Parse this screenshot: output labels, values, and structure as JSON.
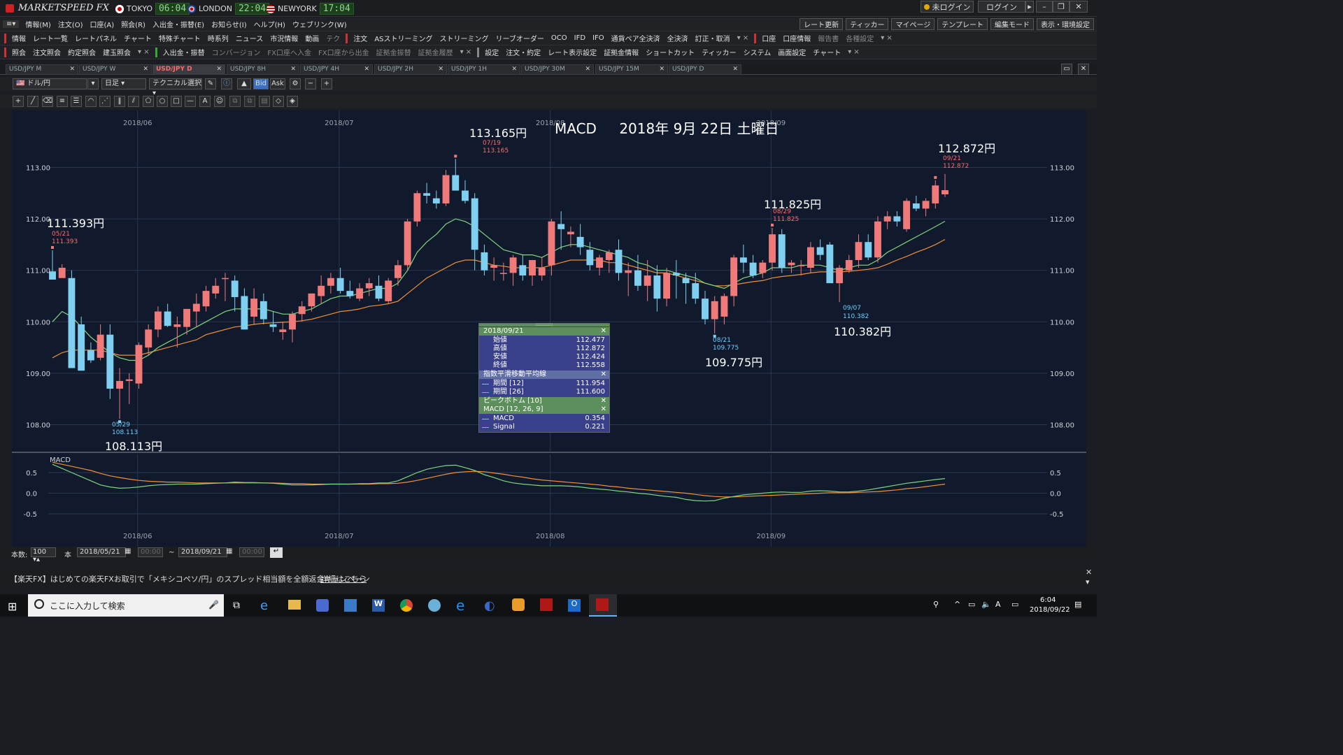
{
  "app": {
    "title": "MARKETSPEED FX"
  },
  "clocks": [
    {
      "city": "TOKYO",
      "time": "06:04"
    },
    {
      "city": "LONDON",
      "time": "22:04"
    },
    {
      "city": "NEWYORK",
      "time": "17:04"
    }
  ],
  "topright": {
    "status": "未ログイン",
    "login": "ログイン"
  },
  "menu": [
    "情報(M)",
    "注文(O)",
    "口座(A)",
    "照会(R)",
    "入出金・振替(E)",
    "お知らせ(I)",
    "ヘルプ(H)",
    "ウェブリンク(W)"
  ],
  "toolbar1_left": [
    "情報",
    "レート一覧",
    "レートパネル",
    "チャート",
    "特殊チャート",
    "時系列",
    "ニュース",
    "市況情報",
    "動画",
    "テク"
  ],
  "toolbar1_mid": [
    "注文",
    "ASストリーミング",
    "ストリーミング",
    "リーブオーダー",
    "OCO",
    "IFD",
    "IFO",
    "通貨ペア全決済",
    "全決済",
    "訂正・取消"
  ],
  "toolbar1_right": [
    "口座",
    "口座情報",
    "報告書",
    "各種設定"
  ],
  "toolbar1_far": [
    "レート更新",
    "ティッカー",
    "マイページ",
    "テンプレート",
    "編集モード",
    "表示・環境設定"
  ],
  "toolbar2_left": [
    "照会",
    "注文照会",
    "約定照会",
    "建玉照会"
  ],
  "toolbar2_mid": [
    "入出金・振替",
    "コンバージョン",
    "FX口座へ入金",
    "FX口座から出金",
    "証拠金振替",
    "証拠金履歴"
  ],
  "toolbar2_right": [
    "設定",
    "注文・約定",
    "レート表示設定",
    "証拠金情報",
    "ショートカット",
    "ティッカー",
    "システム",
    "画面設定",
    "チャート"
  ],
  "tabs": [
    "USD/JPY M",
    "USD/JPY W",
    "USD/JPY D",
    "USD/JPY 8H",
    "USD/JPY 4H",
    "USD/JPY 2H",
    "USD/JPY 1H",
    "USD/JPY 30M",
    "USD/JPY 15M",
    "USD/JPY D"
  ],
  "active_tab": 2,
  "chart_toolbar": {
    "pair": "ドル/円",
    "timeframe": "日足",
    "technical": "テクニカル選択",
    "bid": "Bid",
    "ask": "Ask"
  },
  "chart_header": {
    "indicator": "MACD",
    "date": "2018年 9月 22日 土曜日"
  },
  "annotations": {
    "a1_big": "111.393円",
    "a1_date": "05/21",
    "a1_val": "111.393",
    "a2_big": "108.113円",
    "a2_date": "05/29",
    "a2_val": "108.113",
    "a3_big": "113.165円",
    "a3_date": "07/19",
    "a3_val": "113.165",
    "a4_big": "109.775円",
    "a4_date": "08/21",
    "a4_val": "109.775",
    "a5_big": "111.825円",
    "a5_date": "08/29",
    "a5_val": "111.825",
    "a6_big": "110.382円",
    "a6_date": "09/07",
    "a6_val": "110.382",
    "a7_big": "112.872円",
    "a7_date": "09/21",
    "a7_val": "112.872"
  },
  "infobox": {
    "date": "2018/09/21",
    "ohlc": [
      {
        "label": "始値",
        "value": "112.477"
      },
      {
        "label": "高値",
        "value": "112.872"
      },
      {
        "label": "安値",
        "value": "112.424"
      },
      {
        "label": "終値",
        "value": "112.558"
      }
    ],
    "ema_title": "指数平滑移動平均線",
    "ema": [
      {
        "label": "期間 [12]",
        "value": "111.954"
      },
      {
        "label": "期間 [26]",
        "value": "111.600"
      }
    ],
    "peak_title": "ピークボトム [10]",
    "macd_title": "MACD [12, 26, 9]",
    "macd": [
      {
        "label": "MACD",
        "value": "0.354"
      },
      {
        "label": "Signal",
        "value": "0.221"
      }
    ]
  },
  "bottombar": {
    "count_label": "本数:",
    "count": "100",
    "unit": "本",
    "from": "2018/05/21",
    "time_from": "00:00",
    "tilde": "~",
    "to": "2018/09/21",
    "time_to": "00:00"
  },
  "news": {
    "text": "【楽天FX】はじめての楽天FXお取引で「メキシコペソ/円」のスプレッド相当額を全額返金キャンペーン",
    "link": "詳細はこちら"
  },
  "taskbar": {
    "search_placeholder": "ここに入力して検索",
    "time": "6:04",
    "date": "2018/09/22",
    "ime": "A"
  },
  "chart_data": {
    "type": "candlestick",
    "price_axis": {
      "ylim": [
        107.5,
        113.5
      ],
      "ticks": [
        108.0,
        109.0,
        110.0,
        111.0,
        112.0,
        113.0
      ],
      "tick_labels": [
        "108.00",
        "109.00",
        "110.00",
        "111.00",
        "112.00",
        "113.00"
      ]
    },
    "macd_axis": {
      "ylim": [
        -0.75,
        0.75
      ],
      "ticks": [
        0.5,
        0.0,
        -0.5
      ],
      "tick_labels": [
        "0.5",
        "0.0",
        "-0.5"
      ]
    },
    "month_labels": [
      {
        "label": "2018/06",
        "index": 8
      },
      {
        "label": "2018/07",
        "index": 29
      },
      {
        "label": "2018/08",
        "index": 51
      },
      {
        "label": "2018/09",
        "index": 74
      }
    ],
    "macd_label": "MACD",
    "candles": [
      [
        110.98,
        111.39,
        110.82,
        110.82
      ],
      [
        110.85,
        111.12,
        110.95,
        111.05
      ],
      [
        110.85,
        111.0,
        109.1,
        109.1
      ],
      [
        109.95,
        110.1,
        109.05,
        109.05
      ],
      [
        109.45,
        109.6,
        109.2,
        109.25
      ],
      [
        109.3,
        109.95,
        109.25,
        109.75
      ],
      [
        109.75,
        109.95,
        108.5,
        108.7
      ],
      [
        108.7,
        109.1,
        108.113,
        108.85
      ],
      [
        108.85,
        109.0,
        108.4,
        108.88
      ],
      [
        108.8,
        109.6,
        108.7,
        109.55
      ],
      [
        109.5,
        109.95,
        109.35,
        109.85
      ],
      [
        109.85,
        110.3,
        109.7,
        110.2
      ],
      [
        110.2,
        110.35,
        109.9,
        109.92
      ],
      [
        109.9,
        110.1,
        109.5,
        109.95
      ],
      [
        109.9,
        110.25,
        109.75,
        110.25
      ],
      [
        110.2,
        110.55,
        109.9,
        110.35
      ],
      [
        110.3,
        110.7,
        110.2,
        110.6
      ],
      [
        110.55,
        110.85,
        110.45,
        110.7
      ],
      [
        110.85,
        110.95,
        110.4,
        110.85
      ],
      [
        110.8,
        110.9,
        110.2,
        110.48
      ],
      [
        110.5,
        110.65,
        109.85,
        109.85
      ],
      [
        110.1,
        110.65,
        109.95,
        110.45
      ],
      [
        110.4,
        110.55,
        109.95,
        110.05
      ],
      [
        109.95,
        110.2,
        109.8,
        109.9
      ],
      [
        109.8,
        110.0,
        109.65,
        109.85
      ],
      [
        109.85,
        110.2,
        109.6,
        110.15
      ],
      [
        110.15,
        110.4,
        110.0,
        110.3
      ],
      [
        110.3,
        110.55,
        110.2,
        110.55
      ],
      [
        110.5,
        110.9,
        110.35,
        110.7
      ],
      [
        110.7,
        110.95,
        110.55,
        110.85
      ],
      [
        110.85,
        111.05,
        110.55,
        110.6
      ],
      [
        110.6,
        110.8,
        110.45,
        110.5
      ],
      [
        110.45,
        110.75,
        110.4,
        110.65
      ],
      [
        110.65,
        110.85,
        110.5,
        110.75
      ],
      [
        110.7,
        110.9,
        110.4,
        110.45
      ],
      [
        110.4,
        110.85,
        110.35,
        110.8
      ],
      [
        110.85,
        111.2,
        110.7,
        111.1
      ],
      [
        111.1,
        112.0,
        111.0,
        111.95
      ],
      [
        111.95,
        112.55,
        111.85,
        112.5
      ],
      [
        112.5,
        112.7,
        112.3,
        112.45
      ],
      [
        112.4,
        112.55,
        112.2,
        112.3
      ],
      [
        112.3,
        112.95,
        112.25,
        112.85
      ],
      [
        112.85,
        113.165,
        112.6,
        112.55
      ],
      [
        112.55,
        112.75,
        112.3,
        112.35
      ],
      [
        112.4,
        112.5,
        111.0,
        111.4
      ],
      [
        111.35,
        111.5,
        110.9,
        111.0
      ],
      [
        111.05,
        111.25,
        110.8,
        111.1
      ],
      [
        110.95,
        111.15,
        110.8,
        110.95
      ],
      [
        110.95,
        111.3,
        110.7,
        111.25
      ],
      [
        111.1,
        111.3,
        110.8,
        110.9
      ],
      [
        110.9,
        111.2,
        110.7,
        111.2
      ],
      [
        110.9,
        111.25,
        110.8,
        111.05
      ],
      [
        111.1,
        112.0,
        110.9,
        111.95
      ],
      [
        111.9,
        112.15,
        111.4,
        111.8
      ],
      [
        111.7,
        111.85,
        111.45,
        111.75
      ],
      [
        111.65,
        111.9,
        111.3,
        111.45
      ],
      [
        111.4,
        111.55,
        111.0,
        111.1
      ],
      [
        111.05,
        111.3,
        110.9,
        111.25
      ],
      [
        111.2,
        111.4,
        110.95,
        111.35
      ],
      [
        111.4,
        111.6,
        110.8,
        110.95
      ],
      [
        110.95,
        111.15,
        110.5,
        111.0
      ],
      [
        111.0,
        111.3,
        110.6,
        110.7
      ],
      [
        110.7,
        111.2,
        110.4,
        110.9
      ],
      [
        110.9,
        111.1,
        110.2,
        110.45
      ],
      [
        110.45,
        111.05,
        110.3,
        110.95
      ],
      [
        110.95,
        111.2,
        110.45,
        110.9
      ],
      [
        110.85,
        110.95,
        110.35,
        110.75
      ],
      [
        110.75,
        110.95,
        110.35,
        110.45
      ],
      [
        110.45,
        110.6,
        109.95,
        110.05
      ],
      [
        110.05,
        110.5,
        109.775,
        110.4
      ],
      [
        110.1,
        110.55,
        109.95,
        110.5
      ],
      [
        110.5,
        111.3,
        110.3,
        111.25
      ],
      [
        111.25,
        111.5,
        110.95,
        111.15
      ],
      [
        111.15,
        111.3,
        110.85,
        110.9
      ],
      [
        110.95,
        111.2,
        110.85,
        111.15
      ],
      [
        111.15,
        111.825,
        111.0,
        111.7
      ],
      [
        111.7,
        111.8,
        110.95,
        111.05
      ],
      [
        111.1,
        111.2,
        110.95,
        111.15
      ],
      [
        111.1,
        111.2,
        110.9,
        111.1
      ],
      [
        111.05,
        111.55,
        110.95,
        111.45
      ],
      [
        111.45,
        111.6,
        111.2,
        111.3
      ],
      [
        111.5,
        111.55,
        110.85,
        110.75
      ],
      [
        110.75,
        111.1,
        110.382,
        111.05
      ],
      [
        111.0,
        111.3,
        110.95,
        111.2
      ],
      [
        111.2,
        111.7,
        111.05,
        111.55
      ],
      [
        111.55,
        111.7,
        111.2,
        111.25
      ],
      [
        111.25,
        112.05,
        111.15,
        111.95
      ],
      [
        111.95,
        112.15,
        111.8,
        112.05
      ],
      [
        112.05,
        112.15,
        111.85,
        111.95
      ],
      [
        111.8,
        112.4,
        111.75,
        112.35
      ],
      [
        112.3,
        112.45,
        112.15,
        112.2
      ],
      [
        112.2,
        112.4,
        112.05,
        112.35
      ],
      [
        112.3,
        112.75,
        112.2,
        112.65
      ],
      [
        112.477,
        112.872,
        112.424,
        112.558
      ]
    ],
    "ema12": [
      110.0,
      110.2,
      110.1,
      109.9,
      109.7,
      109.55,
      109.4,
      109.3,
      109.25,
      109.25,
      109.35,
      109.5,
      109.6,
      109.7,
      109.8,
      109.9,
      110.0,
      110.1,
      110.2,
      110.25,
      110.25,
      110.25,
      110.25,
      110.2,
      110.15,
      110.15,
      110.2,
      110.25,
      110.35,
      110.45,
      110.5,
      110.5,
      110.55,
      110.6,
      110.65,
      110.65,
      110.75,
      111.0,
      111.35,
      111.55,
      111.7,
      111.9,
      112.0,
      111.95,
      111.85,
      111.7,
      111.55,
      111.4,
      111.35,
      111.3,
      111.3,
      111.25,
      111.35,
      111.45,
      111.5,
      111.5,
      111.45,
      111.4,
      111.35,
      111.3,
      111.25,
      111.15,
      111.1,
      111.0,
      111.0,
      110.95,
      110.9,
      110.85,
      110.75,
      110.7,
      110.65,
      110.75,
      110.85,
      110.9,
      110.95,
      111.05,
      111.05,
      111.05,
      111.1,
      111.1,
      111.1,
      111.05,
      111.0,
      111.05,
      111.1,
      111.1,
      111.2,
      111.35,
      111.45,
      111.55,
      111.65,
      111.75,
      111.85,
      111.954
    ],
    "ema26": [
      109.3,
      109.4,
      109.45,
      109.45,
      109.45,
      109.45,
      109.4,
      109.35,
      109.35,
      109.35,
      109.4,
      109.45,
      109.5,
      109.55,
      109.6,
      109.65,
      109.75,
      109.8,
      109.85,
      109.9,
      109.92,
      109.95,
      109.97,
      109.98,
      109.99,
      110.0,
      110.02,
      110.05,
      110.1,
      110.15,
      110.2,
      110.22,
      110.25,
      110.3,
      110.32,
      110.35,
      110.4,
      110.55,
      110.7,
      110.85,
      110.95,
      111.05,
      111.15,
      111.2,
      111.2,
      111.15,
      111.1,
      111.08,
      111.05,
      111.05,
      111.05,
      111.05,
      111.1,
      111.15,
      111.2,
      111.2,
      111.2,
      111.2,
      111.15,
      111.15,
      111.1,
      111.05,
      111.0,
      110.95,
      110.95,
      110.9,
      110.85,
      110.8,
      110.75,
      110.7,
      110.7,
      110.72,
      110.75,
      110.78,
      110.8,
      110.85,
      110.88,
      110.9,
      110.92,
      110.95,
      110.97,
      110.97,
      110.97,
      110.98,
      111.0,
      111.02,
      111.05,
      111.12,
      111.2,
      111.27,
      111.35,
      111.42,
      111.5,
      111.6
    ],
    "macd": [
      0.7,
      0.6,
      0.5,
      0.4,
      0.3,
      0.2,
      0.15,
      0.12,
      0.13,
      0.15,
      0.18,
      0.2,
      0.21,
      0.22,
      0.22,
      0.22,
      0.23,
      0.24,
      0.25,
      0.27,
      0.26,
      0.26,
      0.25,
      0.24,
      0.22,
      0.2,
      0.2,
      0.2,
      0.21,
      0.22,
      0.22,
      0.22,
      0.23,
      0.23,
      0.25,
      0.25,
      0.3,
      0.4,
      0.5,
      0.58,
      0.63,
      0.67,
      0.68,
      0.62,
      0.55,
      0.45,
      0.38,
      0.3,
      0.25,
      0.22,
      0.2,
      0.18,
      0.18,
      0.18,
      0.17,
      0.15,
      0.12,
      0.1,
      0.08,
      0.05,
      0.03,
      0.0,
      -0.02,
      -0.05,
      -0.08,
      -0.1,
      -0.15,
      -0.18,
      -0.19,
      -0.18,
      -0.12,
      -0.08,
      -0.04,
      -0.02,
      0.0,
      0.02,
      0.03,
      0.02,
      0.02,
      0.05,
      0.06,
      0.05,
      0.03,
      0.03,
      0.05,
      0.08,
      0.12,
      0.16,
      0.2,
      0.24,
      0.27,
      0.3,
      0.33,
      0.354
    ],
    "signal": [
      0.75,
      0.7,
      0.65,
      0.6,
      0.55,
      0.48,
      0.42,
      0.38,
      0.34,
      0.31,
      0.29,
      0.28,
      0.27,
      0.27,
      0.26,
      0.25,
      0.25,
      0.25,
      0.25,
      0.25,
      0.25,
      0.25,
      0.25,
      0.25,
      0.24,
      0.23,
      0.23,
      0.22,
      0.22,
      0.22,
      0.22,
      0.22,
      0.22,
      0.22,
      0.23,
      0.23,
      0.24,
      0.27,
      0.31,
      0.36,
      0.41,
      0.46,
      0.5,
      0.52,
      0.53,
      0.52,
      0.49,
      0.46,
      0.42,
      0.39,
      0.35,
      0.32,
      0.3,
      0.28,
      0.26,
      0.24,
      0.22,
      0.2,
      0.17,
      0.15,
      0.12,
      0.1,
      0.08,
      0.06,
      0.04,
      0.02,
      0.0,
      -0.03,
      -0.06,
      -0.08,
      -0.09,
      -0.09,
      -0.08,
      -0.07,
      -0.06,
      -0.05,
      -0.04,
      -0.03,
      -0.02,
      -0.01,
      0.0,
      0.01,
      0.01,
      0.01,
      0.02,
      0.03,
      0.04,
      0.06,
      0.08,
      0.11,
      0.13,
      0.16,
      0.19,
      0.221
    ]
  }
}
